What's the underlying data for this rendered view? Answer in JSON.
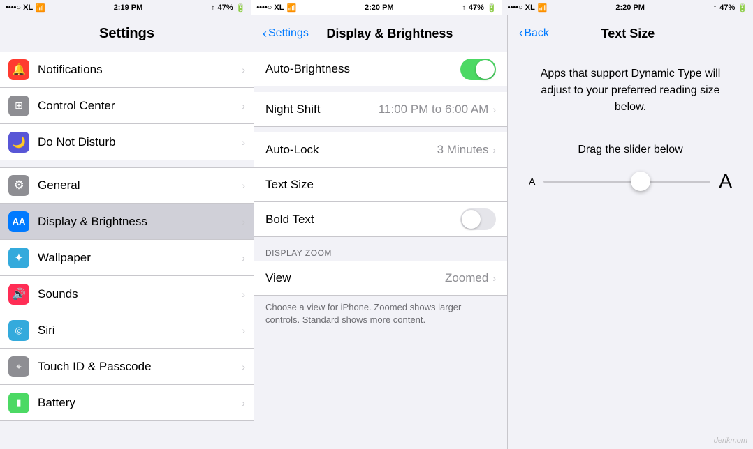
{
  "statusBar": {
    "left": {
      "signal": "••••○ XL",
      "wifi": "▲",
      "time": "2:19 PM",
      "location": "⬆",
      "battery": "47%"
    },
    "middle": {
      "signal": "••••○ XL",
      "wifi": "▲",
      "time": "2:20 PM",
      "location": "⬆",
      "battery": "47%"
    },
    "right": {
      "signal": "••••○ XL",
      "wifi": "▲",
      "time": "2:20 PM",
      "location": "⬆",
      "battery": "47%"
    }
  },
  "leftPanel": {
    "title": "Settings",
    "backLabel": null,
    "items_group1": [
      {
        "id": "notifications",
        "label": "Notifications",
        "iconBg": "#ff3b30",
        "iconColor": "#fff",
        "iconSymbol": "🔔"
      },
      {
        "id": "control-center",
        "label": "Control Center",
        "iconBg": "#8e8e93",
        "iconColor": "#fff",
        "iconSymbol": "⊞"
      },
      {
        "id": "do-not-disturb",
        "label": "Do Not Disturb",
        "iconBg": "#5856d6",
        "iconColor": "#fff",
        "iconSymbol": "🌙"
      }
    ],
    "items_group2": [
      {
        "id": "general",
        "label": "General",
        "iconBg": "#8e8e93",
        "iconColor": "#fff",
        "iconSymbol": "⚙"
      },
      {
        "id": "display-brightness",
        "label": "Display & Brightness",
        "iconBg": "#007aff",
        "iconColor": "#fff",
        "iconSymbol": "AA",
        "active": true
      },
      {
        "id": "wallpaper",
        "label": "Wallpaper",
        "iconBg": "#34aadc",
        "iconColor": "#fff",
        "iconSymbol": "❋"
      },
      {
        "id": "sounds",
        "label": "Sounds",
        "iconBg": "#ff2d55",
        "iconColor": "#fff",
        "iconSymbol": "🔊"
      },
      {
        "id": "siri",
        "label": "Siri",
        "iconBg": "#34aadc",
        "iconColor": "#fff",
        "iconSymbol": "◎"
      },
      {
        "id": "touch-id",
        "label": "Touch ID & Passcode",
        "iconBg": "#8e8e93",
        "iconColor": "#fff",
        "iconSymbol": "⌖"
      },
      {
        "id": "battery",
        "label": "Battery",
        "iconBg": "#4cd964",
        "iconColor": "#fff",
        "iconSymbol": "▮"
      }
    ]
  },
  "middlePanel": {
    "title": "Display & Brightness",
    "backLabel": "Settings",
    "items": [
      {
        "id": "auto-brightness",
        "label": "Auto-Brightness",
        "type": "toggle",
        "toggleOn": true,
        "value": null
      },
      {
        "id": "night-shift",
        "label": "Night Shift",
        "type": "nav",
        "value": "11:00 PM to 6:00 AM"
      },
      {
        "id": "auto-lock",
        "label": "Auto-Lock",
        "type": "nav",
        "value": "3 Minutes"
      },
      {
        "id": "text-size",
        "label": "Text Size",
        "type": "nav",
        "value": null
      },
      {
        "id": "bold-text",
        "label": "Bold Text",
        "type": "toggle",
        "toggleOn": false,
        "value": null
      }
    ],
    "displayZoomSection": "DISPLAY ZOOM",
    "zoomItem": {
      "id": "view",
      "label": "View",
      "type": "nav",
      "value": "Zoomed"
    },
    "zoomDesc": "Choose a view for iPhone. Zoomed shows larger controls. Standard shows more content."
  },
  "rightPanel": {
    "title": "Text Size",
    "backLabel": "Back",
    "description": "Apps that support Dynamic Type will adjust to your preferred reading size below.",
    "sliderLabel": "Drag the slider below",
    "sliderSmallA": "A",
    "sliderLargeA": "A",
    "sliderPosition": 58
  },
  "arrows": [
    {
      "id": "arrow-left-1",
      "target": "display-brightness"
    },
    {
      "id": "arrow-left-2",
      "target": "text-size"
    }
  ],
  "watermark": "derikmom"
}
